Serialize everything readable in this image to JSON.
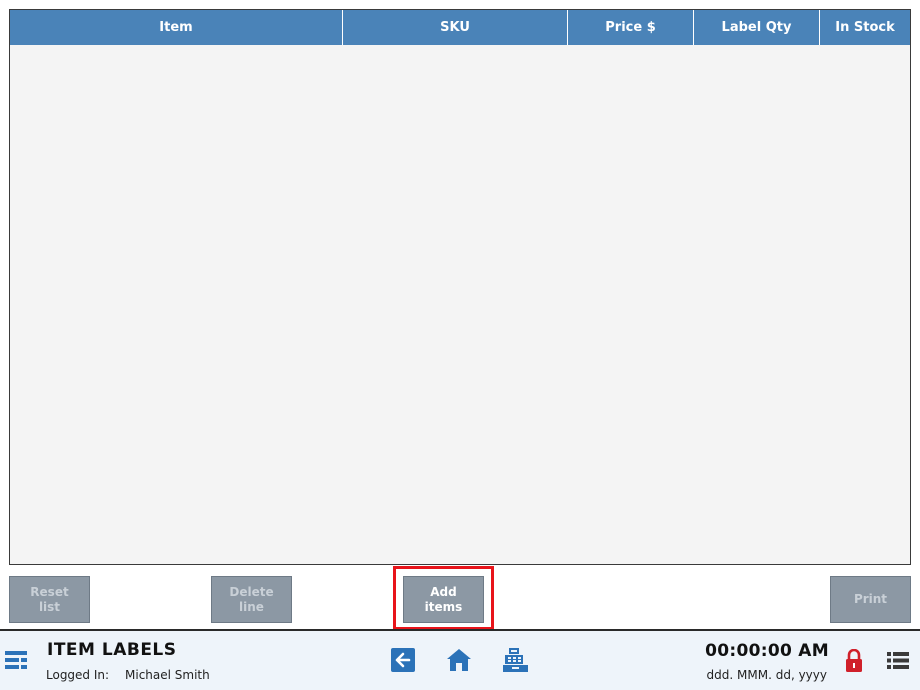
{
  "table": {
    "columns": [
      "Item",
      "SKU",
      "Price $",
      "Label Qty",
      "In Stock"
    ],
    "rows": []
  },
  "actions": {
    "reset_list": "Reset\nlist",
    "delete_line": "Delete\nline",
    "add_items": "Add\nitems",
    "print": "Print"
  },
  "status_bar": {
    "title": "ITEM LABELS",
    "logged_in_label": "Logged In:",
    "user_name": "Michael Smith",
    "clock": "00:00:00 AM",
    "date_format": "ddd. MMM. dd, yyyy"
  },
  "colors": {
    "header_blue": "#4a83b8",
    "button_gray": "#8c98a4",
    "highlight_red": "#e8141a",
    "lock_red": "#d0202a",
    "icon_blue": "#2b72b8"
  },
  "icons": {
    "menu": "grid-menu-icon",
    "back": "back-arrow-icon",
    "home": "home-icon",
    "register": "cash-register-icon",
    "lock": "lock-icon",
    "list": "list-icon"
  }
}
